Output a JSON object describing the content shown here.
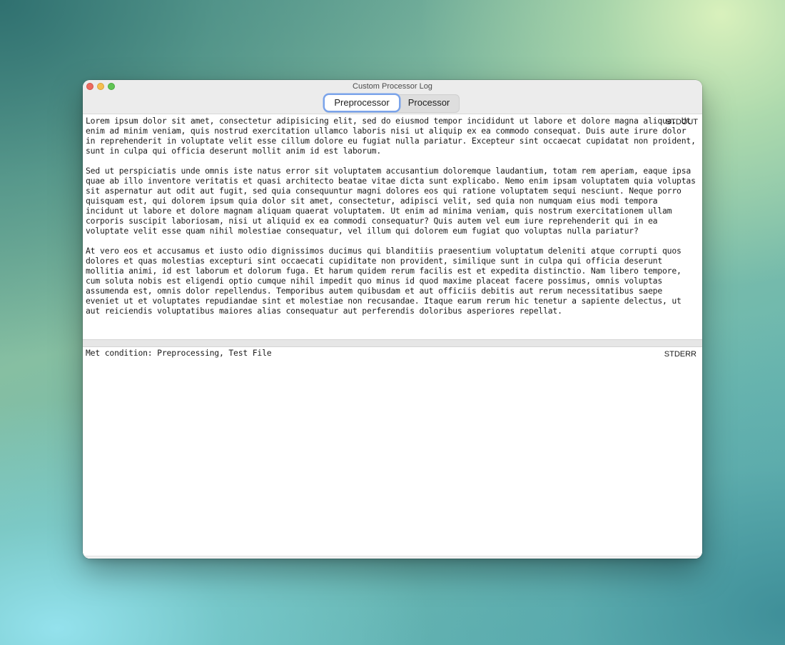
{
  "window": {
    "title": "Custom Processor Log"
  },
  "tabs": [
    {
      "label": "Preprocessor",
      "selected": true
    },
    {
      "label": "Processor",
      "selected": false
    }
  ],
  "stdout": {
    "label": "STDOUT",
    "text": "Lorem ipsum dolor sit amet, consectetur adipisicing elit, sed do eiusmod tempor incididunt ut labore et dolore magna aliqua. Ut enim ad minim veniam, quis nostrud exercitation ullamco laboris nisi ut aliquip ex ea commodo consequat. Duis aute irure dolor in reprehenderit in voluptate velit esse cillum dolore eu fugiat nulla pariatur. Excepteur sint occaecat cupidatat non proident, sunt in culpa qui officia deserunt mollit anim id est laborum.\n\nSed ut perspiciatis unde omnis iste natus error sit voluptatem accusantium doloremque laudantium, totam rem aperiam, eaque ipsa quae ab illo inventore veritatis et quasi architecto beatae vitae dicta sunt explicabo. Nemo enim ipsam voluptatem quia voluptas sit aspernatur aut odit aut fugit, sed quia consequuntur magni dolores eos qui ratione voluptatem sequi nesciunt. Neque porro quisquam est, qui dolorem ipsum quia dolor sit amet, consectetur, adipisci velit, sed quia non numquam eius modi tempora incidunt ut labore et dolore magnam aliquam quaerat voluptatem. Ut enim ad minima veniam, quis nostrum exercitationem ullam corporis suscipit laboriosam, nisi ut aliquid ex ea commodi consequatur? Quis autem vel eum iure reprehenderit qui in ea voluptate velit esse quam nihil molestiae consequatur, vel illum qui dolorem eum fugiat quo voluptas nulla pariatur?\n\nAt vero eos et accusamus et iusto odio dignissimos ducimus qui blanditiis praesentium voluptatum deleniti atque corrupti quos dolores et quas molestias excepturi sint occaecati cupiditate non provident, similique sunt in culpa qui officia deserunt mollitia animi, id est laborum et dolorum fuga. Et harum quidem rerum facilis est et expedita distinctio. Nam libero tempore, cum soluta nobis est eligendi optio cumque nihil impedit quo minus id quod maxime placeat facere possimus, omnis voluptas assumenda est, omnis dolor repellendus. Temporibus autem quibusdam et aut officiis debitis aut rerum necessitatibus saepe eveniet ut et voluptates repudiandae sint et molestiae non recusandae. Itaque earum rerum hic tenetur a sapiente delectus, ut aut reiciendis voluptatibus maiores alias consequatur aut perferendis doloribus asperiores repellat."
  },
  "stderr": {
    "label": "STDERR",
    "text": "Met condition: Preprocessing, Test File"
  },
  "colors": {
    "tab_focus_ring": "#7aa3ea",
    "close": "#ed6a5e",
    "minimize": "#f5bf4f",
    "maximize": "#61c554"
  }
}
